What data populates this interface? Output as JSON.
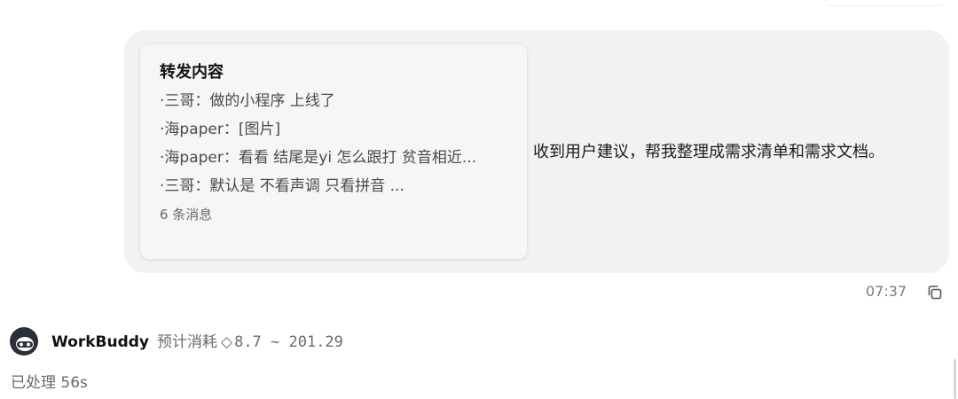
{
  "forwarded": {
    "title": "转发内容",
    "lines": [
      "·三哥：做的小程序 上线了",
      "·海paper：[图片]",
      "·海paper：看看 结尾是yi 怎么跟打 贫音相近...",
      "·三哥：默认是 不看声调 只看拼音 ..."
    ],
    "count": "6 条消息"
  },
  "message": {
    "text": "收到用户建议，帮我整理成需求清单和需求文档。",
    "time": "07:37"
  },
  "assistant": {
    "name": "WorkBuddy",
    "cost_label": "预计消耗",
    "cost_icon": "diamond-outline-icon",
    "cost_range": "8.7 ~ 201.29",
    "processed": "已处理 56s"
  },
  "colors": {
    "bubble_bg": "#f2f2f2",
    "card_bg": "#f7f6f6",
    "muted_text": "#6b6b6b",
    "avatar_dark": "#2b2f36"
  }
}
